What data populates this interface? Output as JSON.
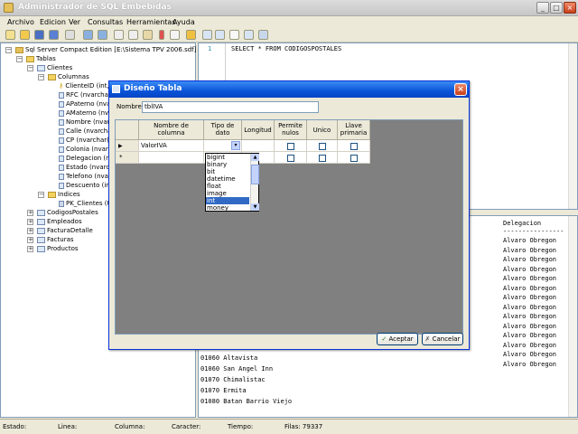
{
  "app": {
    "title": "Administrador de SQL Embebidas"
  },
  "menu": [
    "Archivo",
    "Edicion",
    "Ver",
    "Consultas",
    "Herramientas",
    "Ayuda"
  ],
  "toolbar_icons": [
    "new-icon",
    "open-icon",
    "save-icon",
    "save-all-icon",
    "print-icon",
    "undo-icon",
    "redo-icon",
    "cut-icon",
    "copy-icon",
    "paste-icon",
    "execute-icon",
    "clear-icon",
    "pencil-icon",
    "grid-icon",
    "text-icon",
    "file-icon",
    "list-icon",
    "parse-icon"
  ],
  "tree": {
    "root": "Sql Server Compact Edition [E:\\Sistema TPV 2006.sdf]",
    "tables": "Tablas",
    "table1": "Clientes",
    "columns": "Columnas",
    "cols": [
      "ClienteID (int, n",
      "RFC (nvarchar",
      "APaterno (nvarc",
      "AMaterno (nvarc",
      "Nombre (nvarcha",
      "Calle (nvarchar",
      "CP (nvarchar(5",
      "Colonia (nvarchar",
      "Delegacion (nvar",
      "Estado (nvarchar",
      "Telefono (nvarc",
      "Descuento (int"
    ],
    "indexes": "Indices",
    "pk": "PK_Clientes (U",
    "others": [
      "CodigosPostales",
      "Empleados",
      "FacturaDetalle",
      "Facturas",
      "Productos"
    ]
  },
  "editor": {
    "line": "1",
    "sql": "SELECT * FROM CODIGOSPOSTALES"
  },
  "results": {
    "header": "Delegacion",
    "separator": "----------------",
    "delegaciones": [
      "Alvaro Obregon",
      "Alvaro Obregon",
      "Alvaro Obregon",
      "Alvaro Obregon",
      "Alvaro Obregon",
      "Alvaro Obregon",
      "Alvaro Obregon",
      "Alvaro Obregon",
      "Alvaro Obregon",
      "Alvaro Obregon",
      "Alvaro Obregon",
      "Alvaro Obregon",
      "Alvaro Obregon",
      "Alvaro Obregon"
    ],
    "rows": [
      "01060 Altavista",
      "01060 San Angel Inn",
      "01070 Chimalistac",
      "01070 Ermita",
      "01080 Batan Barrio Viejo"
    ]
  },
  "dialog": {
    "title": "Diseño Tabla",
    "name_label": "Nombre:",
    "name_value": "tblIVA",
    "headers": [
      "Nombre de columna",
      "Tipo de dato",
      "Longitud",
      "Permite nulos",
      "Unico",
      "Llave primaria"
    ],
    "row1_name": "ValorIVA",
    "row_marker": "▶",
    "new_marker": "*",
    "types": [
      "bigint",
      "binary",
      "bit",
      "datetime",
      "float",
      "image",
      "int",
      "money"
    ],
    "selected_type": "int",
    "ok": "Aceptar",
    "cancel": "Cancelar"
  },
  "status": {
    "estado": "Estado:",
    "linea": "Linea:",
    "columna": "Columna:",
    "caracter": "Caracter:",
    "tiempo": "Tiempo:",
    "filas": "Filas: 79337"
  }
}
